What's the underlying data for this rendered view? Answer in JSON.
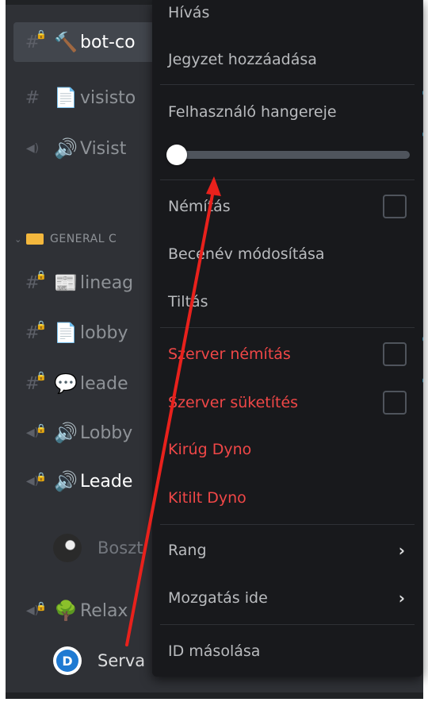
{
  "channels": {
    "items": [
      {
        "prefix": "#",
        "locked": true,
        "emoji": "🔨",
        "name": "bot-co",
        "selected": true
      },
      {
        "prefix": "#",
        "locked": false,
        "emoji": "📄",
        "name": "visisto",
        "selected": false
      },
      {
        "prefix": "◀)",
        "locked": false,
        "emoji": "🔊",
        "name": "Visist",
        "selected": false
      }
    ],
    "category": "GENERAL C",
    "category_items": [
      {
        "prefix": "#",
        "locked": true,
        "emoji": "📰",
        "name": "lineag",
        "bright": false
      },
      {
        "prefix": "#",
        "locked": true,
        "emoji": "📄",
        "name": "lobby",
        "bright": false
      },
      {
        "prefix": "#",
        "locked": true,
        "emoji": "💬",
        "name": "leade",
        "bright": false
      },
      {
        "prefix": "◀)",
        "locked": true,
        "emoji": "🔊",
        "name": "Lobby",
        "bright": false
      },
      {
        "prefix": "◀)",
        "locked": true,
        "emoji": "🔊",
        "name": "Leade",
        "bright": true
      }
    ],
    "voice_user_1": "Boszt",
    "relax_channel": {
      "prefix": "◀)",
      "locked": true,
      "emoji": "🌳",
      "name": "Relax"
    },
    "voice_user_2": "Serva",
    "voice_user_2_avatar_letter": "D"
  },
  "menu": {
    "call": "Hívás",
    "add_note": "Jegyzet hozzáadása",
    "user_volume": "Felhasználó hangereje",
    "volume_level": 0.0,
    "mute": "Némítás",
    "change_nickname": "Becenév módosítása",
    "block": "Tiltás",
    "server_mute": "Szerver némítás",
    "server_deafen": "Szerver süketítés",
    "kick": "Kirúg Dyno",
    "ban": "Kitilt Dyno",
    "role": "Rang",
    "move_to": "Mozgatás ide",
    "copy_id": "ID másolása"
  },
  "colors": {
    "background": "#2f3136",
    "menu_background": "#18191c",
    "danger_text": "#f04747",
    "annotation_arrow": "#e8211c"
  }
}
